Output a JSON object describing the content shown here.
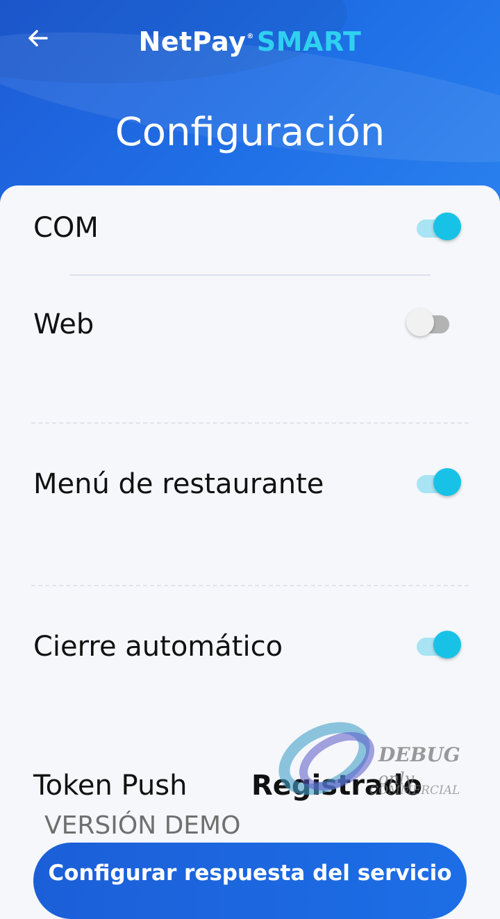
{
  "header": {
    "logo_net": "NetPay",
    "logo_reg": "®",
    "logo_smart": "SMART",
    "title": "Configuración",
    "back_icon": "arrow-left-icon"
  },
  "settings": [
    {
      "label": "COM",
      "enabled": true
    },
    {
      "label": "Web",
      "enabled": false
    },
    {
      "label": "Menú de restaurante",
      "enabled": true
    },
    {
      "label": "Cierre automático",
      "enabled": true
    }
  ],
  "token": {
    "label": "Token Push",
    "value": "Registrado"
  },
  "version_label": "VERSIÓN DEMO",
  "primary_button": "Configurar respuesta del servicio",
  "watermark": {
    "line1": "DEBUG",
    "line1_small": "only",
    "line2": "COMMERCIAL"
  },
  "colors": {
    "header": "#1f6fe6",
    "accent": "#18c2e6",
    "button": "#1b5fd8"
  }
}
